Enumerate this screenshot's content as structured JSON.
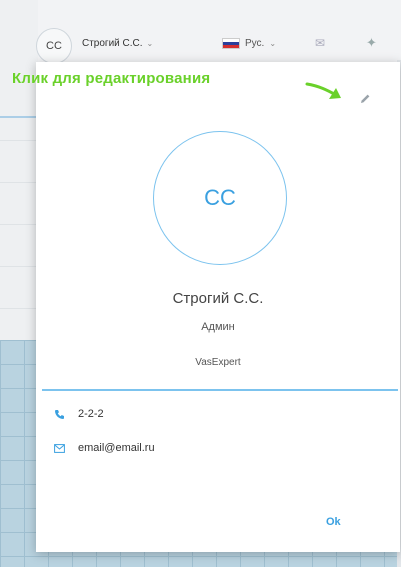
{
  "header": {
    "avatar_initials": "CC",
    "user_name": "Строгий С.С.",
    "language": "Рус.",
    "icons": [
      "chevron-down-icon",
      "flag-icon",
      "mail-icon",
      "pin-icon"
    ]
  },
  "annotation": {
    "text": "Клик для редактирования",
    "color": "#6ad12a"
  },
  "profile": {
    "initials": "CC",
    "name": "Строгий С.С.",
    "role": "Админ",
    "organization": "VasExpert",
    "phone": "2-2-2",
    "email": "email@email.ru",
    "ok_label": "Ok",
    "accent": "#3aa0e0"
  }
}
